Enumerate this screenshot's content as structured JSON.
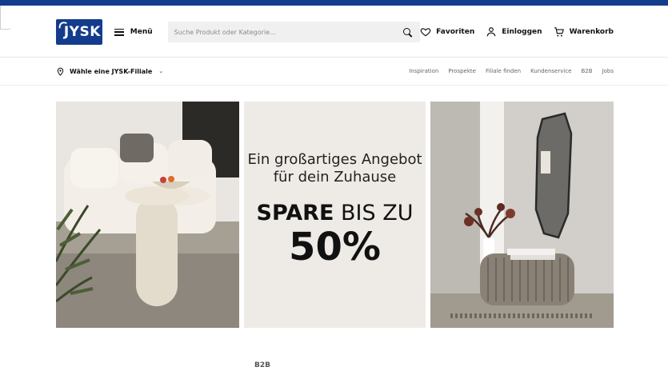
{
  "brand": {
    "logo_text": "JYSK",
    "accent_color": "#143c8c"
  },
  "header": {
    "menu_label": "Menü",
    "search_placeholder": "Suche Produkt oder Kategorie...",
    "favorites_label": "Favoriten",
    "login_label": "Einloggen",
    "cart_label": "Warenkorb"
  },
  "subnav": {
    "store_label": "Wähle eine JYSK-Filiale",
    "links": [
      "Inspiration",
      "Prospekte",
      "Filiale finden",
      "Kundenservice",
      "B2B",
      "Jobs"
    ]
  },
  "banner": {
    "headline": "Ein großartiges Angebot für dein Zuhause",
    "save_bold": "SPARE",
    "save_rest": " BIS ZU",
    "percent": "50%"
  },
  "footer_peek": {
    "b2b_label": "B2B"
  },
  "icons": [
    "hamburger-icon",
    "search-icon",
    "heart-icon",
    "user-icon",
    "cart-icon",
    "location-pin-icon",
    "chevron-down-icon"
  ]
}
